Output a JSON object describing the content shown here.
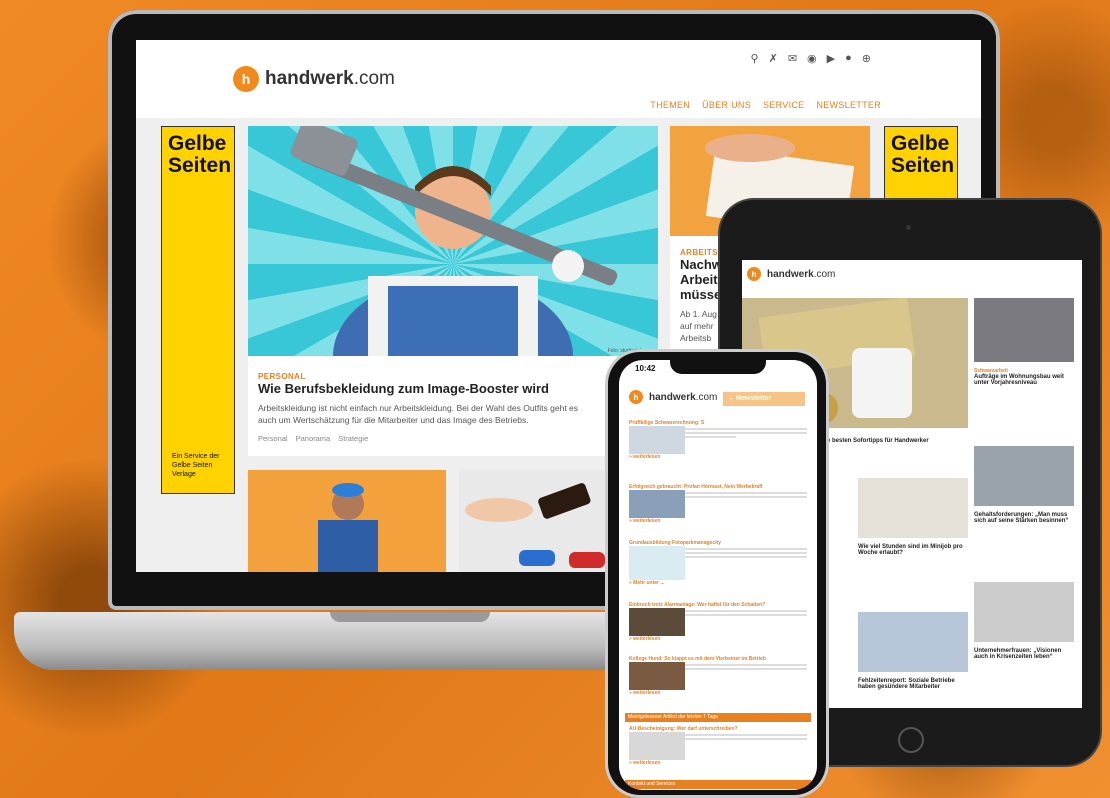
{
  "brand": {
    "name_bold": "handwerk",
    "name_rest": ".com",
    "badge": "h",
    "accent": "#e8801f"
  },
  "laptop": {
    "nav": [
      "THEMEN",
      "ÜBER UNS",
      "SERVICE",
      "NEWSLETTER"
    ],
    "header_icons": [
      "search-icon",
      "xing-icon",
      "mail-icon",
      "facebook-icon",
      "play-icon",
      "apple-icon",
      "plus-icon"
    ],
    "ad_left": {
      "title_line1": "Gelbe",
      "title_line2": "Seiten",
      "foot1": "Ein Service der",
      "foot2": "Gelbe Seiten",
      "foot3": "Verlage"
    },
    "ad_right": {
      "title_line1": "Gelbe",
      "title_line2": "Seiten"
    },
    "hero_credit": "Foto: studiostoks - ...",
    "hero": {
      "kicker": "PERSONAL",
      "title": "Wie Berufsbekleidung zum Image-Booster wird",
      "teaser1": "Arbeitskleidung ist nicht einfach nur Arbeitskleidung. Bei der Wahl des Outfits geht es",
      "teaser2": "auch um Wertschätzung für die Mitarbeiter und das Image des Betriebs.",
      "tags": [
        "Personal",
        "Panorama",
        "Strategie"
      ]
    },
    "side_article": {
      "kicker": "ARBEITSR",
      "line1": "Nachw",
      "line2": "Arbeit",
      "line3": "müsse",
      "t1": "Ab 1. Aug",
      "t2": "auf mehr",
      "t3": "Arbeitsb"
    }
  },
  "tablet": {
    "feature_title": "e besten Sofortipps für Handwerker",
    "card1": {
      "kicker": "Schwarzarbeit",
      "title": "Aufträge im Wohnungsbau weit unter Vorjahresniveau"
    },
    "card2": {
      "kicker": "Gehaltsforderungen",
      "title": "Gehaltsforderungen: „Man muss sich auf seine Stärken besinnen“"
    },
    "card3": {
      "title": "Wie viel Stunden sind im Minijob pro Woche erlaubt?"
    },
    "card4": {
      "title": "Unternehmerfrauen: „Visionen auch in Krisenzeiten leben“"
    },
    "card5": {
      "title": "Fehlzeitenreport: Soziale Betriebe haben gesündere Mitarbeiter"
    }
  },
  "phone": {
    "time": "10:42",
    "newsletter_btn": "→ Newsletter",
    "items": [
      {
        "kicker": "Prüffällige Schwarzrechnung: S",
        "more": "» weiterlesen"
      },
      {
        "kicker": "Erfolgreich gebraucht: Profan Hörmast, Nein Werbekraft",
        "more": "» weiterlesen"
      },
      {
        "kicker": "Grundausbildung Fotoparkmanagecity",
        "more": "» Mehr unter ..."
      },
      {
        "kicker": "Einbruch trotz Alarmanlage: Wer haftet für den Schaden?",
        "more": "» weiterlesen"
      },
      {
        "kicker": "Kollege Hund: So klappt es mit dem Vierbeiner im Betrieb",
        "more": "» weiterlesen"
      }
    ],
    "bar1": "Meistgelesener Artikel der letzten 7 Tage",
    "last": {
      "kicker": "AU-Bescheinigung: Wer darf unterschreiben?",
      "more": "» weiterlesen"
    },
    "bar2": "Kontakt und Services"
  }
}
